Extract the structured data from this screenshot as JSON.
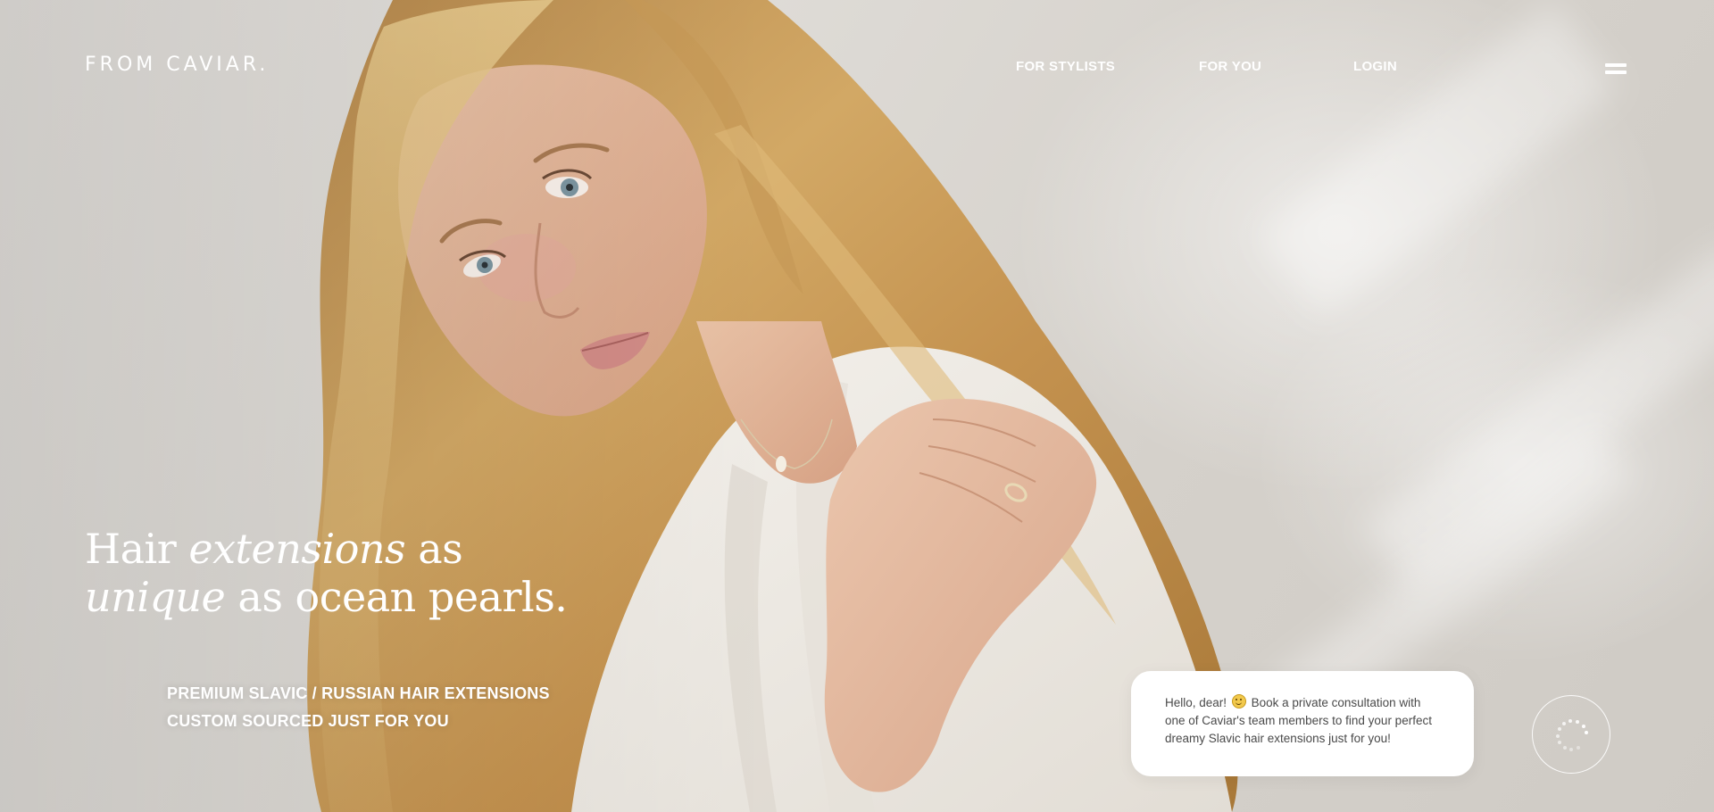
{
  "brand": {
    "logo_text": "FROM CAVIAR."
  },
  "nav": {
    "items": [
      "FOR STYLISTS",
      "FOR YOU",
      "LOGIN"
    ]
  },
  "menu": {
    "icon": "hamburger-menu-icon"
  },
  "hero": {
    "headline_1": "Hair",
    "headline_2": "extensions",
    "headline_3": "as",
    "headline_4": "unique",
    "headline_5": "as ocean pearls.",
    "subline_1": "PREMIUM SLAVIC / RUSSIAN HAIR EXTENSIONS",
    "subline_2": "CUSTOM SOURCED JUST FOR YOU"
  },
  "chat": {
    "greeting": "Hello, dear!",
    "emoji_icon": "smiling-face-icon",
    "message": "Book a private consultation with one of Caviar's team members to find your perfect dreamy Slavic hair extensions just for you!",
    "launcher_icon": "loading-spinner-icon"
  },
  "colors": {
    "text_on_image": "#ffffff",
    "chat_bg": "#ffffff",
    "chat_text": "#4a4a4a"
  }
}
